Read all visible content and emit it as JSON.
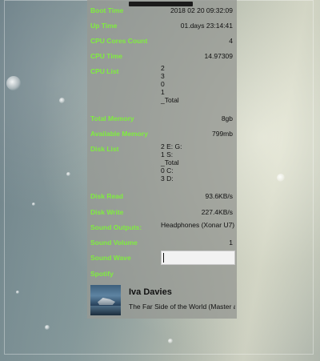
{
  "stats": {
    "boot_time": {
      "label": "Boot Time",
      "value": "2018 02 20 09:32:09"
    },
    "up_time": {
      "label": "Up Time",
      "value": "01.days 23:14:41"
    },
    "cpu_cores": {
      "label": "CPU Cores Count",
      "value": "4"
    },
    "cpu_time": {
      "label": "CPU Time",
      "value": "14.97309"
    },
    "cpu_list": {
      "label": "CPU List",
      "items": [
        "2",
        "3",
        "0",
        "1",
        "_Total"
      ]
    },
    "total_memory": {
      "label": "Total Memory",
      "value": "8gb"
    },
    "available_memory": {
      "label": "Available Memory",
      "value": "799mb"
    },
    "disk_list": {
      "label": "Disk List",
      "items": [
        "2 E: G:",
        "1 S:",
        "_Total",
        "0 C:",
        "3 D:"
      ]
    },
    "disk_read": {
      "label": "Disk Read",
      "value": "93.6KB/s"
    },
    "disk_write": {
      "label": "Disk Write",
      "value": "227.4KB/s"
    },
    "sound_outputs": {
      "label": "Sound Outputs:",
      "value": "Headphones (Xonar U7)"
    },
    "sound_volume": {
      "label": "Sound Volume",
      "value": "1"
    },
    "sound_wave": {
      "label": "Sound Wave",
      "input_value": ""
    },
    "spotify": {
      "label": "Spotify"
    }
  },
  "now_playing": {
    "artist": "Iva Davies",
    "track": "The Far Side of the World (Master and Commander)",
    "album_art_icon": "album-art-ship"
  },
  "colors": {
    "label_green": "#7fee3e",
    "panel_bg": "#96999488",
    "text_dark": "#111111"
  }
}
